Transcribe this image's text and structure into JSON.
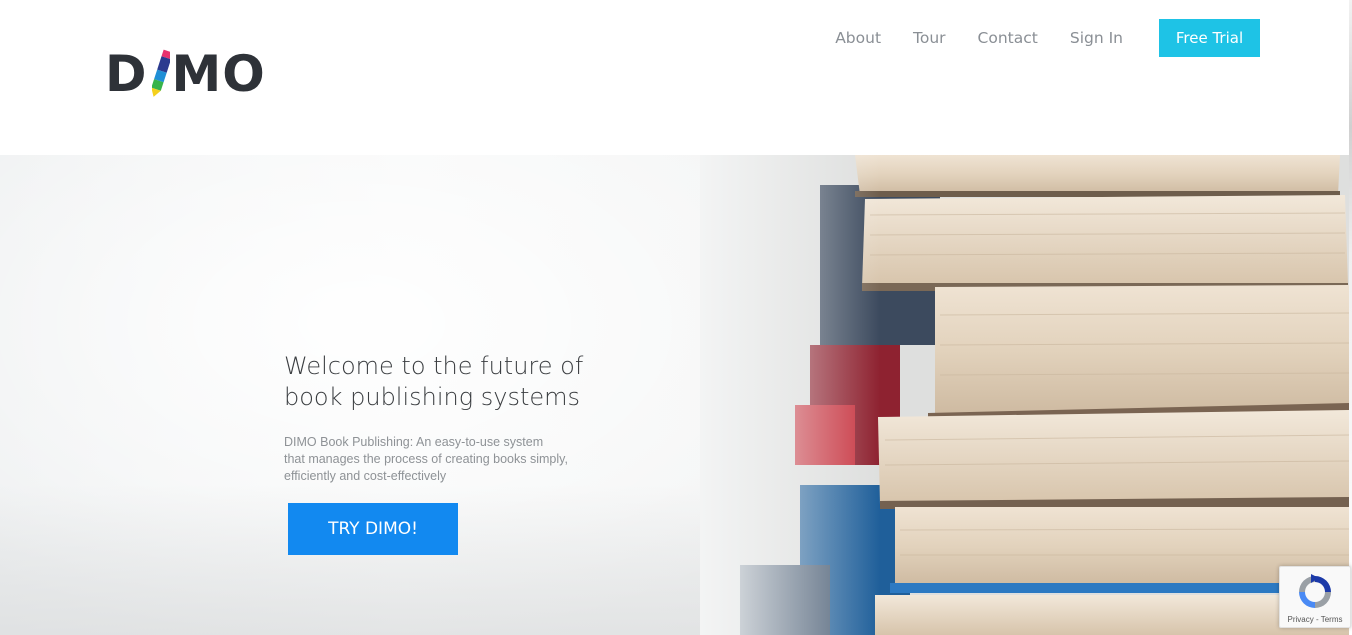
{
  "brand": {
    "logo_left": "D",
    "logo_right": "MO"
  },
  "nav": {
    "items": [
      {
        "label": "About"
      },
      {
        "label": "Tour"
      },
      {
        "label": "Contact"
      },
      {
        "label": "Sign In"
      }
    ],
    "cta_label": "Free Trial"
  },
  "hero": {
    "title_line1": "Welcome to the future of",
    "title_line2": "book publishing systems",
    "desc_line1": "DIMO Book Publishing: An easy-to-use system",
    "desc_line2": "that manages the process of creating books simply,",
    "desc_line3": "efficiently and cost-effectively",
    "cta_label": "TRY DIMO!"
  },
  "recaptcha": {
    "privacy": "Privacy",
    "separator": " - ",
    "terms": "Terms"
  },
  "colors": {
    "accent_cyan": "#1ec3e6",
    "accent_blue": "#1289f0",
    "logo_dark": "#2e3238",
    "nav_text": "#8a8f95"
  }
}
